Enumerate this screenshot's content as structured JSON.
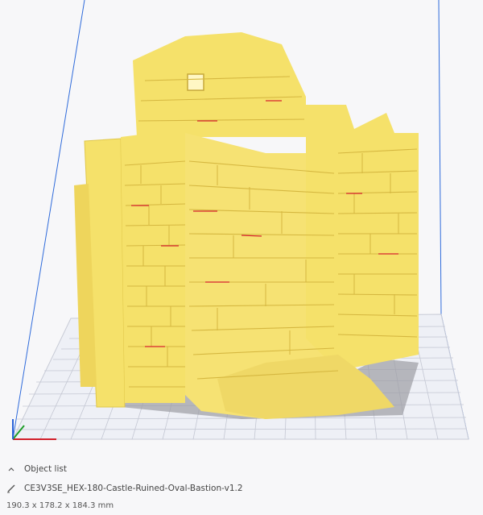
{
  "object_list": {
    "toggle_icon": "chevron-up-icon",
    "label": "Object list"
  },
  "object": {
    "edit_icon": "pencil-icon",
    "name": "CE3V3SE_HEX-180-Castle-Ruined-Oval-Bastion-v1.2",
    "dimensions": "190.3 x 178.2 x 184.3 mm"
  },
  "colors": {
    "model": "#f5e16a",
    "model_shadow": "#e2c84a",
    "grid": "#b9bcc9",
    "build_edge": "#2b63d8"
  }
}
